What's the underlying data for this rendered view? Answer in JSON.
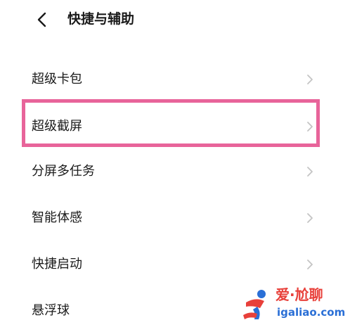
{
  "header": {
    "title": "快捷与辅助",
    "back_icon": "chevron-left-icon"
  },
  "menu": {
    "items": [
      {
        "label": "超级卡包",
        "icon": "chevron-right-icon"
      },
      {
        "label": "超级截屏",
        "icon": "chevron-right-icon",
        "highlighted": true
      },
      {
        "label": "分屏多任务",
        "icon": "chevron-right-icon"
      },
      {
        "label": "智能体感",
        "icon": "chevron-right-icon"
      },
      {
        "label": "快捷启动",
        "icon": "chevron-right-icon"
      },
      {
        "label": "悬浮球",
        "icon": "chevron-right-icon"
      }
    ]
  },
  "watermark": {
    "text_cn": "爱·尬聊",
    "text_en": "igaliao.com"
  },
  "colors": {
    "highlight": "#e8649a",
    "chevron": "#c4c4c4",
    "watermark_red": "#e8403a",
    "watermark_blue": "#2a6fd6"
  }
}
